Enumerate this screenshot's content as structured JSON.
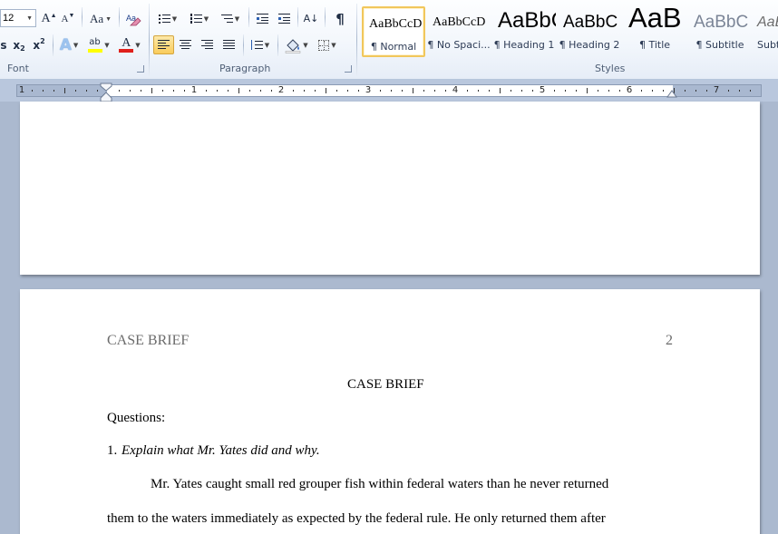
{
  "ribbon": {
    "font_group": {
      "label": "Font",
      "font_size": "12",
      "grow_font": "A",
      "shrink_font": "A",
      "change_case": "Aa",
      "subscript": "x",
      "superscript": "x",
      "text_effects": "A",
      "highlight": "ab",
      "font_color": "A"
    },
    "paragraph_group": {
      "label": "Paragraph",
      "pilcrow": "¶",
      "sort": "A↓"
    },
    "styles_group": {
      "label": "Styles",
      "items": [
        {
          "sample": "AaBbCcD",
          "name": "¶ Normal"
        },
        {
          "sample": "AaBbCcD",
          "name": "¶ No Spaci..."
        },
        {
          "sample": "AaBbC",
          "name": "¶ Heading 1"
        },
        {
          "sample": "AaBbC",
          "name": "¶ Heading 2"
        },
        {
          "sample": "AaB",
          "name": "¶ Title"
        },
        {
          "sample": "AaBbC",
          "name": "¶ Subtitle"
        },
        {
          "sample": "AaBb",
          "name": "Subtl"
        }
      ]
    }
  },
  "ruler": {
    "numbers": [
      "1",
      "1",
      "2",
      "3",
      "4",
      "5",
      "6",
      "7"
    ]
  },
  "document": {
    "running_head": "CASE BRIEF",
    "page_number": "2",
    "title": "CASE BRIEF",
    "questions_label": "Questions:",
    "question_1_number": "1.",
    "question_1_text": "Explain what Mr. Yates did and why.",
    "body_line_1": "Mr. Yates caught small red grouper fish within federal waters than he never returned",
    "body_line_2": "them to the waters immediately as expected by the federal rule.  He only returned them after"
  },
  "colors": {
    "ribbon_bg": "#f3f7fc",
    "workspace_bg": "#abb9cf",
    "selected_highlight": "#f9cc5c",
    "highlight_yellow": "#ffff00",
    "font_color_red": "#e0201b",
    "header_gray": "#6b6b6b"
  }
}
